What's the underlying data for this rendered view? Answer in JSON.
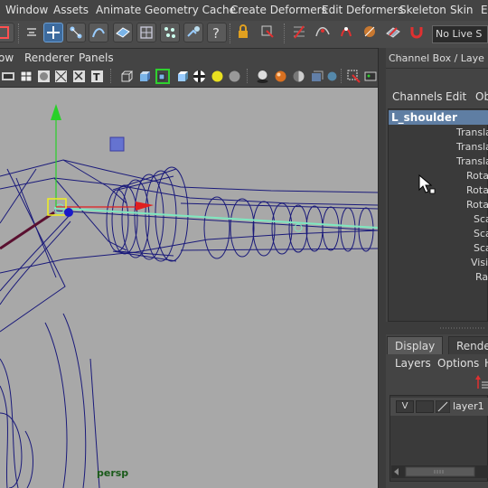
{
  "menubar": {
    "items": [
      "Window",
      "Assets",
      "Animate",
      "Geometry Cache",
      "Create Deformers",
      "Edit Deformers",
      "Skeleton",
      "Skin",
      "Edit"
    ]
  },
  "shelf": {
    "no_live_label": "No Live S"
  },
  "panel_menu": {
    "items": [
      "ow",
      "Renderer",
      "Panels"
    ]
  },
  "viewport": {
    "camera_label": "persp",
    "wire_color": "#1a1a7a",
    "joint_color": "#7fe8c0",
    "background": "#a8a8a8"
  },
  "channel_box": {
    "title": "Channel Box / Laye",
    "menu": [
      "Channels",
      "Edit",
      "Obj"
    ],
    "object_name": "L_shoulder",
    "attributes": [
      "Transla",
      "Transla",
      "Transla",
      "Rota",
      "Rota",
      "Rota",
      "Sca",
      "Sca",
      "Sca",
      "Visi",
      "Ra"
    ]
  },
  "layer_editor": {
    "tabs": [
      "Display",
      "Render"
    ],
    "menu": [
      "Layers",
      "Options",
      "H"
    ],
    "layers": [
      {
        "visible": "V",
        "name": "layer1"
      }
    ]
  }
}
